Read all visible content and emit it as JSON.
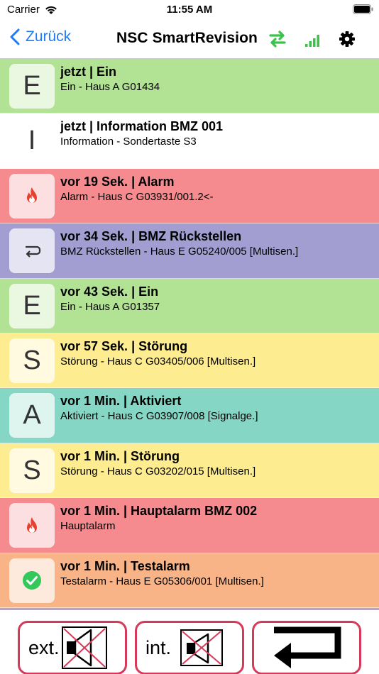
{
  "status_bar": {
    "carrier": "Carrier",
    "time": "11:55 AM"
  },
  "nav": {
    "back_label": "Zurück",
    "title": "NSC SmartRevision"
  },
  "events": [
    {
      "badge": "E",
      "icon": "letter",
      "title": "jetzt | Ein",
      "subtitle": "Ein - Haus A G01434",
      "color": "#b2e394"
    },
    {
      "badge": "I",
      "icon": "letter",
      "title": "jetzt | Information BMZ 001",
      "subtitle": "Information - Sondertaste S3",
      "color": "#ffffff"
    },
    {
      "badge": "",
      "icon": "fire-icon",
      "title": "vor 19 Sek. | Alarm",
      "subtitle": "Alarm - Haus C G03931/001.2<-",
      "color": "#f58b8f"
    },
    {
      "badge": "",
      "icon": "return-arrow-icon",
      "title": "vor 34 Sek. | BMZ Rückstellen",
      "subtitle": "BMZ Rückstellen - Haus E G05240/005 [Multisen.]",
      "color": "#a29ed1"
    },
    {
      "badge": "E",
      "icon": "letter",
      "title": "vor 43 Sek. | Ein",
      "subtitle": "Ein - Haus A G01357",
      "color": "#b2e394"
    },
    {
      "badge": "S",
      "icon": "letter",
      "title": "vor 57 Sek. | Störung",
      "subtitle": "Störung - Haus C G03405/006 [Multisen.]",
      "color": "#fdec90"
    },
    {
      "badge": "A",
      "icon": "letter",
      "title": "vor 1 Min. | Aktiviert",
      "subtitle": "Aktiviert - Haus C G03907/008 [Signalge.]",
      "color": "#86d6c5"
    },
    {
      "badge": "S",
      "icon": "letter",
      "title": "vor 1 Min. | Störung",
      "subtitle": "Störung - Haus C G03202/015 [Multisen.]",
      "color": "#fdec90"
    },
    {
      "badge": "",
      "icon": "fire-icon",
      "title": "vor 1 Min. | Hauptalarm BMZ 002",
      "subtitle": "Hauptalarm",
      "color": "#f58b8f"
    },
    {
      "badge": "",
      "icon": "check-icon",
      "title": "vor 1 Min. | Testalarm",
      "subtitle": "Testalarm - Haus E G05306/001 [Multisen.]",
      "color": "#f8b487"
    }
  ],
  "toolbar": {
    "ext_label": "ext.",
    "int_label": "int."
  },
  "colors": {
    "accent": "#1f7cf5",
    "button_border": "#d63a5a",
    "sync_green": "#3cc24a"
  }
}
